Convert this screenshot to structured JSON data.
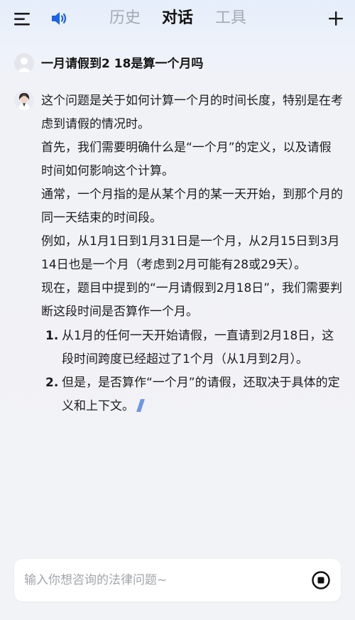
{
  "header": {
    "tabs": [
      {
        "label": "历史",
        "active": false
      },
      {
        "label": "对话",
        "active": true
      },
      {
        "label": "工具",
        "active": false
      }
    ],
    "icons": {
      "menu": "menu-icon",
      "speaker": "speaker-icon",
      "new_chat": "plus-icon"
    },
    "accent_color": "#1b63e8"
  },
  "conversation": {
    "question": "一月请假到2 18是算一个月吗",
    "answer": {
      "paragraphs": [
        "这个问题是关于如何计算一个月的时间长度，特别是在考虑到请假的情况时。",
        "首先，我们需要明确什么是“一个月”的定义，以及请假时间如何影响这个计算。",
        "通常，一个月指的是从某个月的某一天开始，到那个月的同一天结束的时间段。",
        "例如，从1月1日到1月31日是一个月，从2月15日到3月14日也是一个月（考虑到2月可能有28或29天）。",
        "现在，题目中提到的“一月请假到2月18日”，我们需要判断这段时间是否算作一个月。"
      ],
      "list": [
        {
          "num": "1.",
          "text": "从1月的任何一天开始请假，一直请到2月18日，这段时间跨度已经超过了1个月（从1月到2月）。"
        },
        {
          "num": "2.",
          "text": "但是，是否算作“一个月”的请假，还取决于具体的定义和上下文。"
        }
      ]
    }
  },
  "input": {
    "placeholder": "输入你想咨询的法律问题~",
    "value": ""
  }
}
